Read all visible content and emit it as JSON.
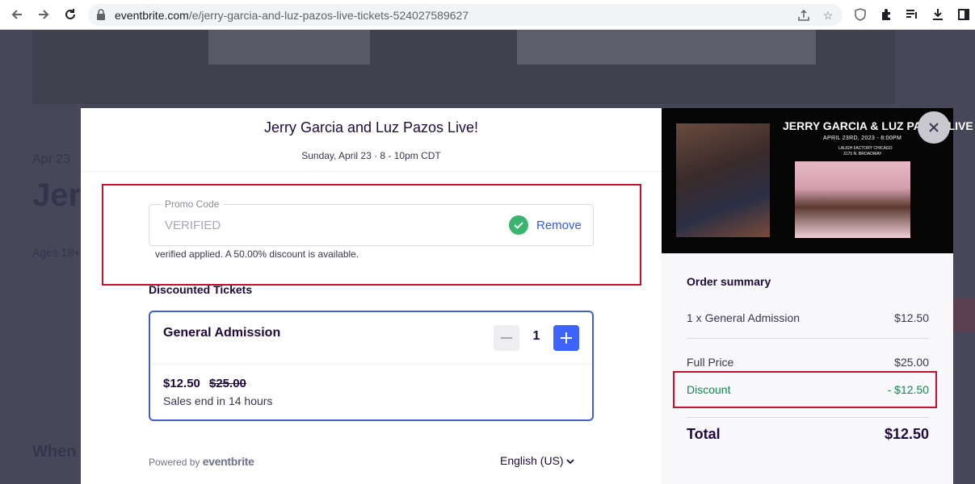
{
  "browser": {
    "url_host": "eventbrite.com",
    "url_path": "/e/jerry-garcia-and-luz-pazos-live-tickets-524027589627"
  },
  "background_page": {
    "date": "Apr 23",
    "title_fragment": "Jer",
    "ages": "Ages 18+",
    "section_heading": "When"
  },
  "checkout": {
    "event_title": "Jerry Garcia and Luz Pazos Live!",
    "event_date": "Sunday, April 23 · 8 - 10pm CDT",
    "promo": {
      "label": "Promo Code",
      "value": "VERIFIED",
      "remove_label": "Remove",
      "message": "verified applied. A 50.00% discount is available."
    },
    "tickets_heading": "Discounted Tickets",
    "ticket": {
      "name": "General Admission",
      "quantity": "1",
      "price": "$12.50",
      "original_price": "$25.00",
      "sales_end": "Sales end in 14 hours"
    },
    "powered_by": "Powered by",
    "brand": "eventbrite",
    "language": "English (US)"
  },
  "event_image": {
    "headline": "JERRY GARCIA & LUZ PAZOS LIVE",
    "date_line": "APRIL 23RD, 2023 - 8:00PM",
    "venue_line1": "LAUGH FACTORY CHICAGO",
    "venue_line2": "3175 N. BROADWAY"
  },
  "order_summary": {
    "title": "Order summary",
    "line_item_label": "1 x General Admission",
    "line_item_value": "$12.50",
    "full_price_label": "Full Price",
    "full_price_value": "$25.00",
    "discount_label": "Discount",
    "discount_value": "- $12.50",
    "total_label": "Total",
    "total_value": "$12.50"
  },
  "colors": {
    "accent_blue": "#3d64ff",
    "discount_green": "#0d8a4d",
    "annotation_red": "#c8102e"
  }
}
